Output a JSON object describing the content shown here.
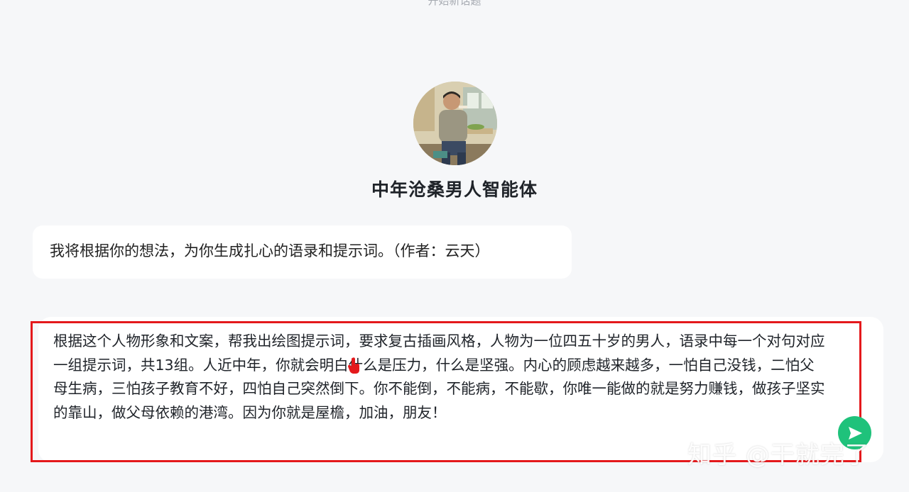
{
  "header": {
    "new_topic_hint": "开始新话题"
  },
  "agent": {
    "name": "中年沧桑男人智能体",
    "avatar_icon": "middle-aged-man-portrait"
  },
  "messages": [
    {
      "role": "agent",
      "text": "我将根据你的想法，为你生成扎心的语录和提示词。（作者：云天）"
    }
  ],
  "composer": {
    "value": "根据这个人物形象和文案，帮我出绘图提示词，要求复古插画风格，人物为一位四五十岁的男人，语录中每一个对句对应一组提示词，共13组。人近中年，你就会明白什么是压力，什么是坚强。内心的顾虑越来越多，一怕自己没钱，二怕父母生病，三怕孩子教育不好，四怕自己突然倒下。你不能倒，不能病，不能歇，你唯一能做的就是努力赚钱，做孩子坚实的靠山，做父母依赖的港湾。因为你就是屋檐，加油，朋友！",
    "send_icon": "send-arrow-icon",
    "accent_color": "#1fc27b"
  },
  "annotation": {
    "highlight_color": "#e4191c"
  },
  "watermark": {
    "text": "知乎 @干就完了"
  }
}
